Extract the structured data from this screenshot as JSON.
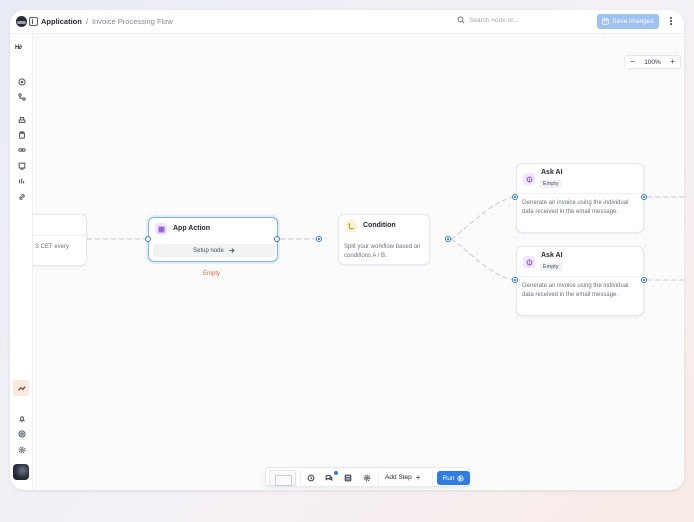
{
  "header": {
    "app_label": "Application",
    "separator": "/",
    "flow_name": "Invoice Processing Flow",
    "search_placeholder": "Search node or...",
    "save_label": "Save changes"
  },
  "rail": {
    "brand": "H∂"
  },
  "canvas": {
    "zoom_level": "100%",
    "zoom_out": "−",
    "zoom_in": "+"
  },
  "nodes": {
    "trigger": {
      "desc": "S CET every"
    },
    "app_action": {
      "title": "App Action",
      "setup_label": "Setup node",
      "status": "Empty"
    },
    "condition": {
      "title": "Condition",
      "desc": "Split your workflow based on conditions A / B."
    },
    "ask_ai_1": {
      "title": "Ask AI",
      "badge": "Empty",
      "desc": "Generate an invoice using the individual data received in the email message."
    },
    "ask_ai_2": {
      "title": "Ask AI",
      "badge": "Empty",
      "desc": "Generate an invoice using the individual data received in the email message."
    }
  },
  "toolbar": {
    "add_step_label": "Add Step",
    "add_icon": "+",
    "run_label": "Run"
  },
  "colors": {
    "accent": "#2f7de1",
    "save_disabled": "#9fc2f3",
    "empty_status": "#e4652a",
    "ai_icon_bg": "#f1e6fb",
    "condition_icon_bg": "#fdf1d6"
  }
}
